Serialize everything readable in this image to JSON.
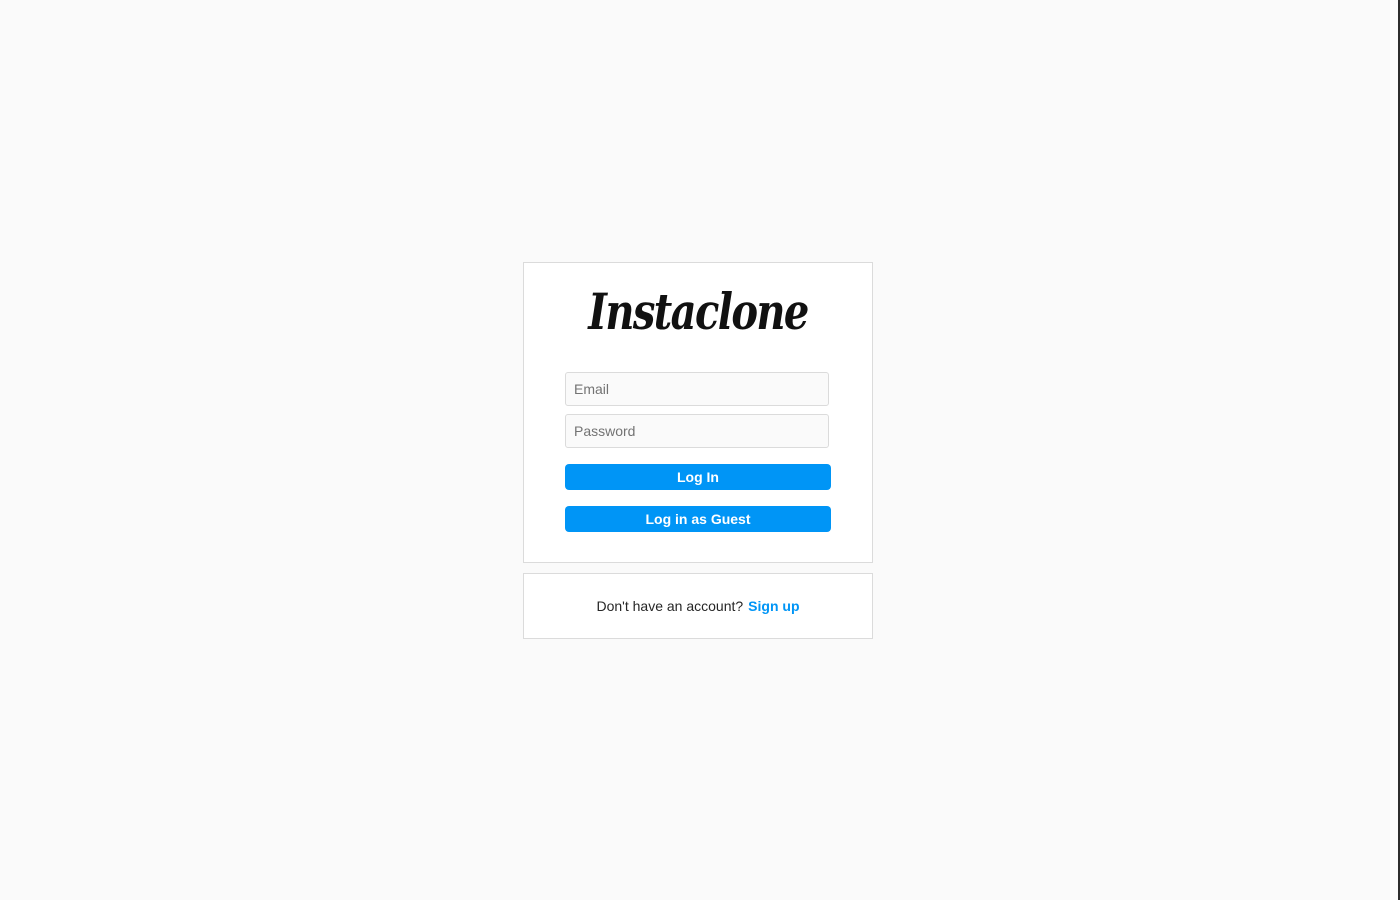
{
  "app": {
    "logo_text": "Instaclone"
  },
  "login_form": {
    "email_placeholder": "Email",
    "password_placeholder": "Password",
    "login_label": "Log In",
    "guest_label": "Log in as Guest"
  },
  "signup": {
    "prompt": "Don't have an account?",
    "link_label": "Sign up"
  },
  "colors": {
    "accent": "#0095f6",
    "background": "#fafafa",
    "card_border": "#dbdbdb"
  }
}
